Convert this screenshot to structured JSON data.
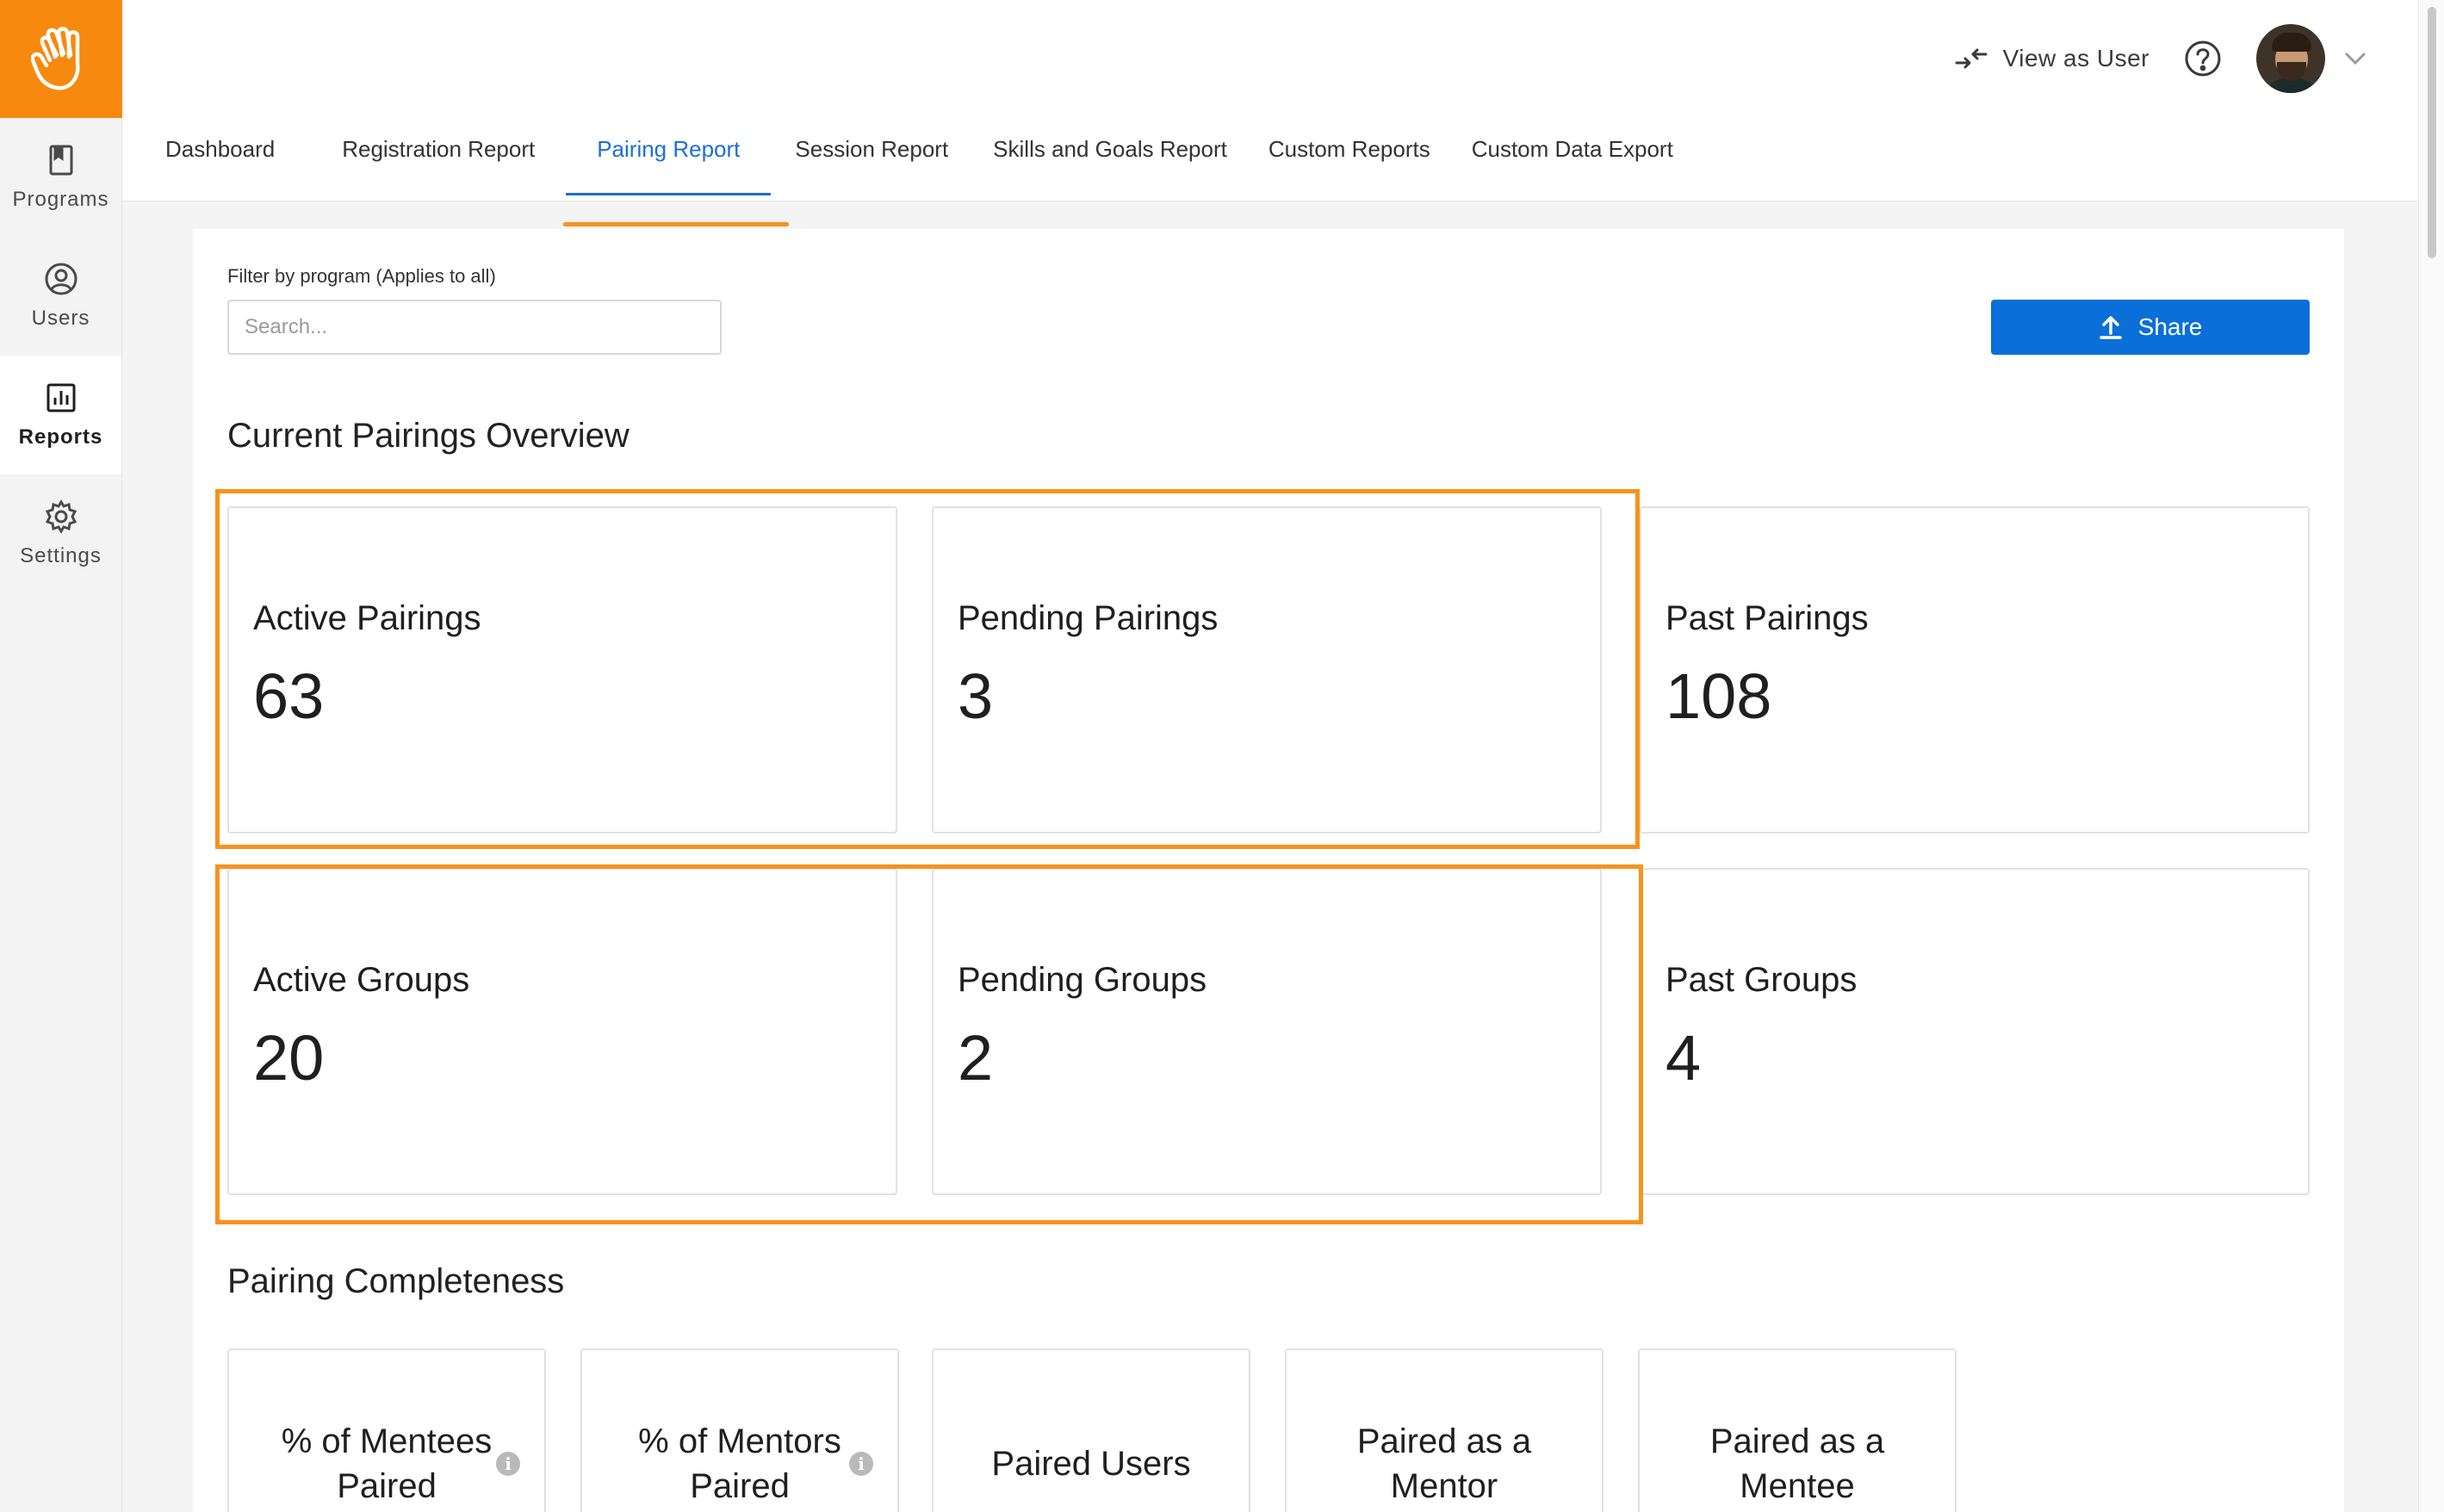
{
  "sidebar": {
    "items": [
      {
        "label": "Programs",
        "icon": "book-icon"
      },
      {
        "label": "Users",
        "icon": "user-circle-icon"
      },
      {
        "label": "Reports",
        "icon": "bar-chart-icon",
        "active": true
      },
      {
        "label": "Settings",
        "icon": "gear-icon"
      }
    ]
  },
  "header": {
    "view_as_user": "View as User",
    "tabs": [
      {
        "label": "Dashboard"
      },
      {
        "label": "Registration Report"
      },
      {
        "label": "Pairing Report",
        "active": true
      },
      {
        "label": "Session Report"
      },
      {
        "label": "Skills and Goals Report"
      },
      {
        "label": "Custom Reports"
      },
      {
        "label": "Custom Data Export"
      }
    ]
  },
  "filter": {
    "label": "Filter by program (Applies to all)",
    "placeholder": "Search...",
    "value": ""
  },
  "share_label": "Share",
  "overview": {
    "title": "Current Pairings Overview",
    "cards": [
      {
        "label": "Active Pairings",
        "value": "63"
      },
      {
        "label": "Pending Pairings",
        "value": "3"
      },
      {
        "label": "Past Pairings",
        "value": "108"
      },
      {
        "label": "Active Groups",
        "value": "20"
      },
      {
        "label": "Pending Groups",
        "value": "2"
      },
      {
        "label": "Past Groups",
        "value": "4"
      }
    ]
  },
  "completeness": {
    "title": "Pairing Completeness",
    "cards": [
      {
        "line1": "% of Mentees",
        "line2": "Paired",
        "info": true
      },
      {
        "line1": "% of Mentors",
        "line2": "Paired",
        "info": true
      },
      {
        "line1": "Paired Users",
        "line2": "",
        "info": false
      },
      {
        "line1": "Paired as a",
        "line2": "Mentor",
        "info": false
      },
      {
        "line1": "Paired as a",
        "line2": "Mentee",
        "info": false
      }
    ]
  },
  "colors": {
    "accent_orange": "#f7931e",
    "primary_blue": "#0a6fd8",
    "tab_active_blue": "#1b6fd6"
  }
}
